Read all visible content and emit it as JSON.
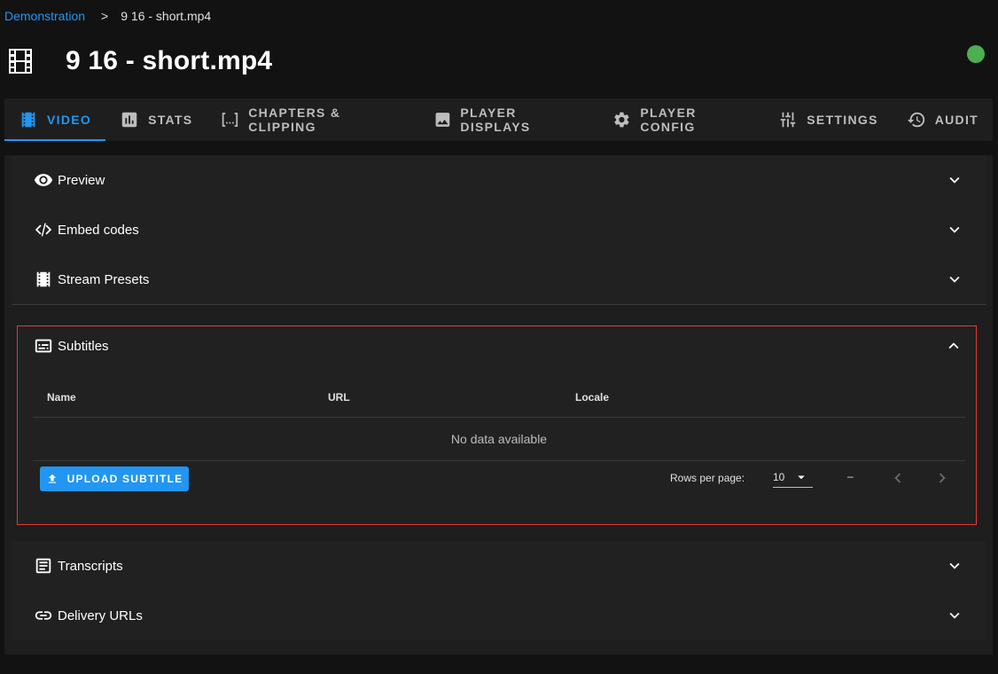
{
  "breadcrumb": {
    "parent": "Demonstration",
    "separator": ">",
    "current": "9 16 - short.mp4"
  },
  "page": {
    "title": "9 16 - short.mp4",
    "status_color": "#4caf50"
  },
  "tabs": [
    {
      "label": "VIDEO",
      "icon": "video-icon",
      "active": true
    },
    {
      "label": "STATS",
      "icon": "stats-icon"
    },
    {
      "label": "CHAPTERS & CLIPPING",
      "icon": "chapters-icon"
    },
    {
      "label": "PLAYER DISPLAYS",
      "icon": "image-icon"
    },
    {
      "label": "PLAYER CONFIG",
      "icon": "gear-icon"
    },
    {
      "label": "SETTINGS",
      "icon": "tune-icon"
    },
    {
      "label": "AUDIT",
      "icon": "history-icon"
    }
  ],
  "panels": {
    "preview": {
      "label": "Preview",
      "icon": "eye-icon"
    },
    "embed": {
      "label": "Embed codes",
      "icon": "code-icon"
    },
    "presets": {
      "label": "Stream Presets",
      "icon": "film-icon"
    },
    "subtitles": {
      "label": "Subtitles",
      "icon": "subtitles-icon",
      "columns": [
        "Name",
        "URL",
        "Locale"
      ],
      "empty_text": "No data available",
      "upload_label": "UPLOAD SUBTITLE",
      "rows_per_page_label": "Rows per page:",
      "rows_per_page_value": "10",
      "range_text": "–"
    },
    "transcripts": {
      "label": "Transcripts",
      "icon": "document-icon"
    },
    "delivery": {
      "label": "Delivery URLs",
      "icon": "link-icon"
    }
  },
  "colors": {
    "accent": "#2196f3",
    "highlight_border": "#e53935",
    "status": "#4caf50"
  }
}
